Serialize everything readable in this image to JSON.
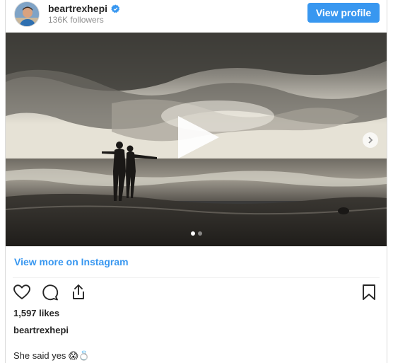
{
  "header": {
    "username": "beartrexhepi",
    "followers": "136K followers",
    "view_profile_label": "View profile"
  },
  "media": {
    "type": "video",
    "carousel_count": 2,
    "active_index": 0
  },
  "links": {
    "view_more": "View more on Instagram"
  },
  "post": {
    "likes": "1,597 likes",
    "caption_username": "beartrexhepi",
    "caption_text": "She said yes 😱💍"
  },
  "colors": {
    "accent": "#3897f0",
    "text": "#262626",
    "muted": "#8e8e8e",
    "border": "#dbdbdb"
  },
  "icons": [
    "verified-badge-icon",
    "play-icon",
    "chevron-right-icon",
    "heart-icon",
    "comment-icon",
    "share-icon",
    "bookmark-icon"
  ]
}
